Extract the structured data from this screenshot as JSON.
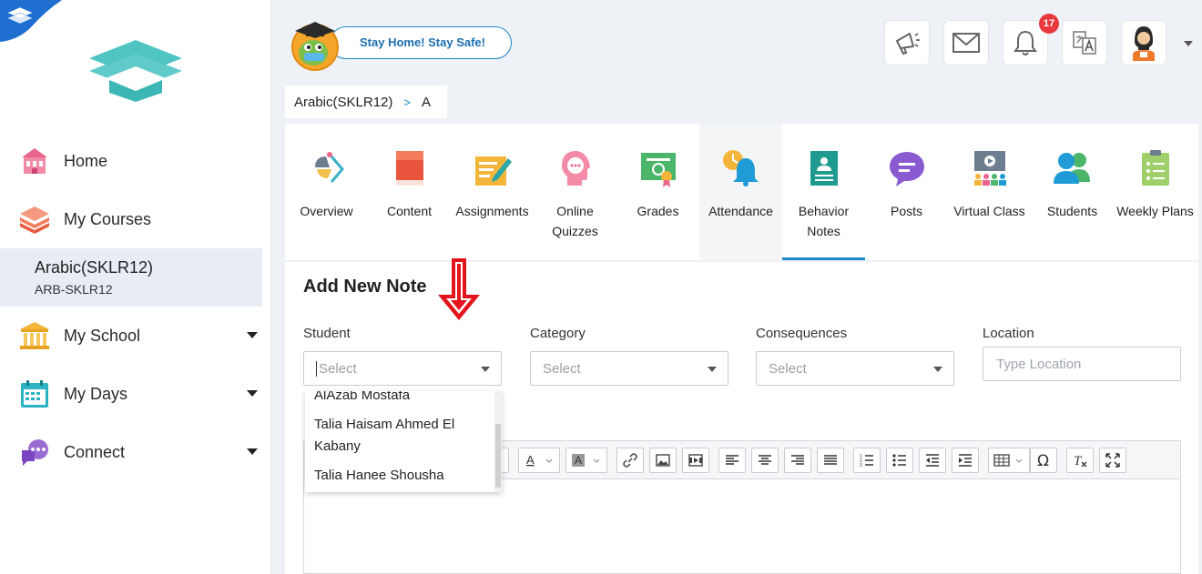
{
  "sidebar": {
    "nav": [
      {
        "label": "Home",
        "icon": "home-icon"
      },
      {
        "label": "My Courses",
        "icon": "courses-icon"
      },
      {
        "label": "My School",
        "icon": "school-icon"
      },
      {
        "label": "My Days",
        "icon": "calendar-icon"
      },
      {
        "label": "Connect",
        "icon": "connect-icon"
      }
    ],
    "active_course": {
      "name": "Arabic(SKLR12)",
      "code": "ARB-SKLR12"
    }
  },
  "header": {
    "banner_text": "Stay Home! Stay Safe!",
    "notification_count": "17"
  },
  "breadcrumb": {
    "course": "Arabic(SKLR12)",
    "separator": ">",
    "section": "A"
  },
  "tabs": [
    {
      "label": "Overview"
    },
    {
      "label": "Content"
    },
    {
      "label": "Assignments"
    },
    {
      "label": "Online Quizzes"
    },
    {
      "label": "Grades"
    },
    {
      "label": "Attendance"
    },
    {
      "label": "Behavior Notes"
    },
    {
      "label": "Posts"
    },
    {
      "label": "Virtual Class"
    },
    {
      "label": "Students"
    },
    {
      "label": "Weekly Plans"
    }
  ],
  "form": {
    "title": "Add New Note",
    "student_label": "Student",
    "student_placeholder": "Select",
    "category_label": "Category",
    "category_placeholder": "Select",
    "consequences_label": "Consequences",
    "consequences_placeholder": "Select",
    "location_label": "Location",
    "location_placeholder": "Type Location"
  },
  "dropdown": {
    "items": [
      "AlAzab Mostafa",
      "Talia Haisam Ahmed El Kabany",
      "Talia Hanee Shousha"
    ]
  },
  "colors": {
    "accent": "#1b8ac9",
    "badge": "#e8383d",
    "annotation": "#e3141c"
  }
}
